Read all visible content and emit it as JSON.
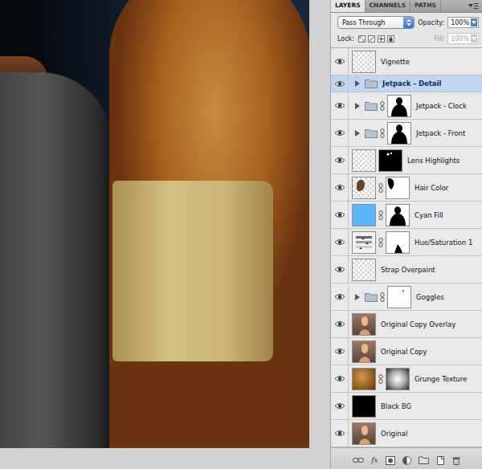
{
  "tabs": [
    {
      "label": "LAYERS",
      "selected": true
    },
    {
      "label": "CHANNELS",
      "selected": false
    },
    {
      "label": "PATHS",
      "selected": false
    }
  ],
  "blend_mode": "Pass Through",
  "opacity": {
    "label": "Opacity:",
    "value": "100%"
  },
  "lock": {
    "label": "Lock:"
  },
  "fill": {
    "label": "Fill:",
    "value": "100%",
    "disabled": true
  },
  "layers": [
    {
      "name": "Vignette",
      "kind": "layer",
      "visible": true,
      "selected": false,
      "thumb": "transparent",
      "mask": "none",
      "linked": false
    },
    {
      "name": "Jetpack - Detail",
      "kind": "group",
      "visible": true,
      "selected": true,
      "expanded": false,
      "thumb": "none",
      "mask": "none",
      "linked": false
    },
    {
      "name": "Jetpack - Clock",
      "kind": "group",
      "visible": true,
      "selected": false,
      "expanded": false,
      "thumb": "none",
      "mask": "silhouette",
      "linked": true
    },
    {
      "name": "Jetpack - Front",
      "kind": "group",
      "visible": true,
      "selected": false,
      "expanded": false,
      "thumb": "none",
      "mask": "silhouette",
      "linked": true
    },
    {
      "name": "Lens Highlights",
      "kind": "layer",
      "visible": true,
      "selected": false,
      "thumb": "transparent",
      "mask": "dots",
      "linked": false
    },
    {
      "name": "Hair Color",
      "kind": "layer",
      "visible": true,
      "selected": false,
      "thumb": "hair",
      "mask": "hair",
      "linked": true
    },
    {
      "name": "Cyan Fill",
      "kind": "fill",
      "visible": true,
      "selected": false,
      "thumb": "solid",
      "color": "#5bb5f9",
      "mask": "silhouette",
      "linked": true
    },
    {
      "name": "Hue/Saturation 1",
      "kind": "adjustment",
      "visible": true,
      "selected": false,
      "thumb": "adjustment",
      "mask": "shape",
      "linked": true
    },
    {
      "name": "Strap Overpaint",
      "kind": "layer",
      "visible": true,
      "selected": false,
      "thumb": "transparent",
      "mask": "none",
      "linked": false
    },
    {
      "name": "Goggles",
      "kind": "group",
      "visible": true,
      "selected": false,
      "expanded": false,
      "thumb": "none",
      "mask": "speck",
      "linked": true
    },
    {
      "name": "Original Copy Overlay",
      "kind": "layer",
      "visible": true,
      "selected": false,
      "thumb": "photo",
      "mask": "none",
      "linked": false
    },
    {
      "name": "Original Copy",
      "kind": "layer",
      "visible": true,
      "selected": false,
      "thumb": "photo",
      "mask": "none",
      "linked": false
    },
    {
      "name": "Grunge Texture",
      "kind": "layer",
      "visible": true,
      "selected": false,
      "thumb": "texture",
      "mask": "radial",
      "linked": true
    },
    {
      "name": "Black BG",
      "kind": "fill",
      "visible": true,
      "selected": false,
      "thumb": "solid",
      "color": "#000000",
      "mask": "none",
      "linked": false
    },
    {
      "name": "Original",
      "kind": "layer",
      "visible": true,
      "selected": false,
      "thumb": "photo",
      "mask": "none",
      "linked": false
    }
  ],
  "footer": {
    "fx": "fx"
  }
}
